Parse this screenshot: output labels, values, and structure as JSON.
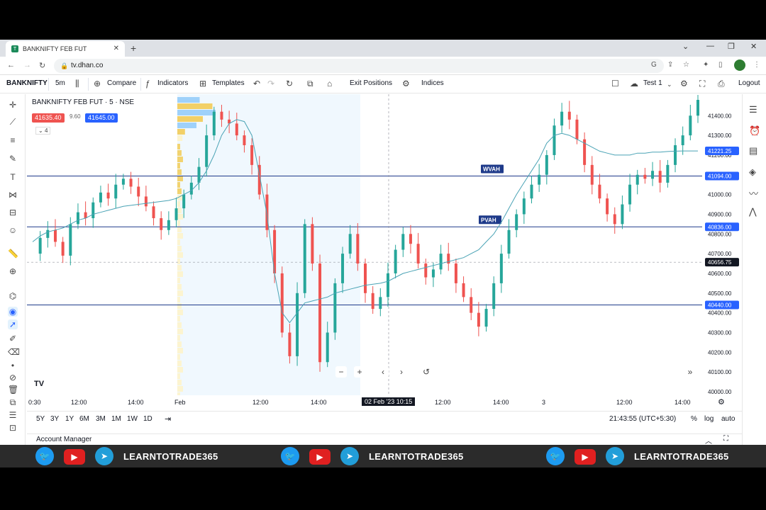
{
  "browser": {
    "tab_title": "BANKNIFTY FEB FUT",
    "url": "tv.dhan.co"
  },
  "toolbar": {
    "symbol": "BANKNIFTY",
    "interval": "5m",
    "compare": "Compare",
    "indicators": "Indicators",
    "templates": "Templates",
    "exit_positions": "Exit Positions",
    "indices": "Indices",
    "layout_name": "Test 1",
    "logout": "Logout"
  },
  "legend": {
    "title": "BANKNIFTY FEB FUT · 5 · NSE",
    "bid": "41635.40",
    "spread": "9.60",
    "ask": "41645.00",
    "count": "4"
  },
  "chart_data": {
    "type": "candlestick",
    "ylim": [
      40000,
      41480
    ],
    "y_ticks": [
      41400,
      41300,
      41200,
      41100,
      41000,
      40900,
      40800,
      40700,
      40600,
      40500,
      40400,
      40300,
      40200,
      40100,
      40000
    ],
    "y_tick_labels": [
      "41400.00",
      "41300.00",
      "41200.00",
      "41100.00",
      "41000.00",
      "40900.00",
      "40800.00",
      "40700.00",
      "40600.00",
      "40500.00",
      "40400.00",
      "40300.00",
      "40200.00",
      "40100.00",
      "40000.00"
    ],
    "x_labels": [
      "0:30",
      "12:00",
      "14:00",
      "Feb",
      "12:00",
      "14:00",
      "12:00",
      "14:00",
      "3",
      "12:00",
      "14:00"
    ],
    "crosshair_time": "02 Feb '23   10:15",
    "horizontal_lines": [
      {
        "name": "WVAH",
        "price": 41094.0,
        "label": "41094.00"
      },
      {
        "name": "PVAH",
        "price": 40836.0,
        "label": "40836.00"
      },
      {
        "name": "",
        "price": 40440.0,
        "label": "40440.00"
      }
    ],
    "last_price_label": "41221.25",
    "last_price": 41221.25,
    "crosshair_price_label": "40656.75",
    "crosshair_price": 40656.75,
    "price_path": [
      40700,
      40780,
      40820,
      40760,
      40690,
      40850,
      40910,
      40880,
      40960,
      41010,
      40980,
      41050,
      41080,
      41040,
      40990,
      40940,
      40880,
      40820,
      40870,
      40930,
      41000,
      41060,
      41140,
      41300,
      41420,
      41380,
      41360,
      41300,
      41250,
      41150,
      41000,
      40820,
      40600,
      40300,
      40180,
      40500,
      40850,
      40650,
      40150,
      40300,
      40550,
      40700,
      40800,
      40650,
      40500,
      40420,
      40480,
      40600,
      40720,
      40800,
      40750,
      40650,
      40580,
      40620,
      40700,
      40650,
      40550,
      40480,
      40400,
      40330,
      40420,
      40550,
      40700,
      40820,
      40900,
      40980,
      41050,
      41100,
      41200,
      41350,
      41420,
      41380,
      41280,
      41150,
      41050,
      40980,
      40900,
      40850,
      40950,
      41050,
      41100,
      41080,
      41120,
      41060,
      41150,
      41250,
      41300,
      41400,
      41480
    ],
    "vwap_path": [
      40760,
      40790,
      40810,
      40820,
      40830,
      40850,
      40870,
      40880,
      40900,
      40910,
      40920,
      40930,
      40940,
      40945,
      40950,
      40955,
      40960,
      40965,
      40970,
      40980,
      41000,
      41020,
      41060,
      41120,
      41200,
      41300,
      41360,
      41380,
      41370,
      41300,
      41100,
      40900,
      40600,
      40400,
      40350,
      40400,
      40450,
      40460,
      40470,
      40480,
      40500,
      40510,
      40520,
      40530,
      40540,
      40545,
      40550,
      40560,
      40580,
      40600,
      40610,
      40620,
      40630,
      40640,
      40650,
      40660,
      40670,
      40680,
      40700,
      40720,
      40760,
      40800,
      40860,
      40930,
      41000,
      41060,
      41120,
      41180,
      41260,
      41300,
      41310,
      41300,
      41280,
      41260,
      41240,
      41220,
      41210,
      41200,
      41200,
      41200,
      41210,
      41210,
      41215,
      41215,
      41218,
      41220,
      41221,
      41221,
      41221
    ]
  },
  "bottombar": {
    "ranges": [
      "5Y",
      "3Y",
      "1Y",
      "6M",
      "3M",
      "1M",
      "1W",
      "1D"
    ],
    "clock": "21:43:55 (UTC+5:30)",
    "percent": "%",
    "log": "log",
    "auto": "auto",
    "account_manager": "Account Manager"
  },
  "footer": {
    "handle": "LEARNTOTRADE365"
  },
  "colors": {
    "up": "#26a69a",
    "down": "#ef5350",
    "hline": "#1e3a8a",
    "label_blue": "#2962ff",
    "vwap": "#4aa3b5",
    "profile_blue": "#64b5f6",
    "profile_yellow": "#f2c94c",
    "profile_bg": "#e3f2fd"
  }
}
